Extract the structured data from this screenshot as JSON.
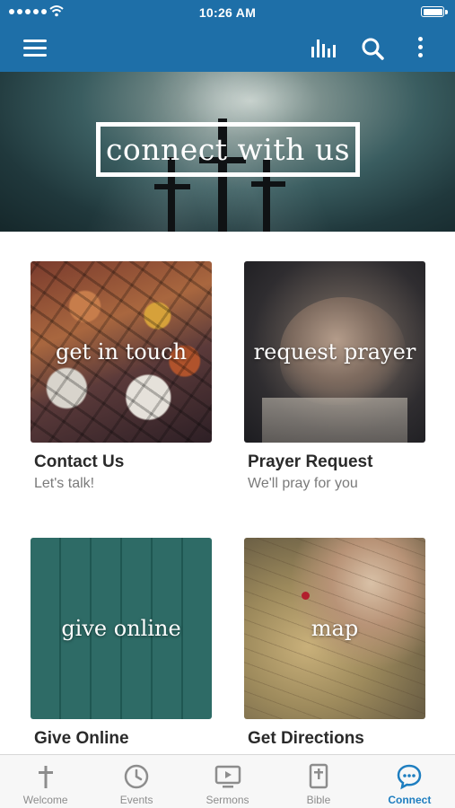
{
  "status_bar": {
    "time": "10:26 AM"
  },
  "colors": {
    "primary": "#1e6fa8",
    "active_tab": "#1e7ec0",
    "inactive_tab": "#8d8d8d"
  },
  "app_bar": {
    "icons": [
      "menu-icon",
      "bar-chart-icon",
      "search-icon",
      "more-vertical-icon"
    ]
  },
  "hero": {
    "title": "connect with us"
  },
  "cards": [
    {
      "overlay": "get in touch",
      "title": "Contact Us",
      "subtitle": "Let's talk!"
    },
    {
      "overlay": "request prayer",
      "title": "Prayer Request",
      "subtitle": "We'll pray for you"
    },
    {
      "overlay": "give online",
      "title": "Give Online",
      "subtitle": ""
    },
    {
      "overlay": "map",
      "title": "Get Directions",
      "subtitle": ""
    }
  ],
  "tabs": [
    {
      "label": "Welcome",
      "icon": "cross-icon",
      "active": false
    },
    {
      "label": "Events",
      "icon": "clock-icon",
      "active": false
    },
    {
      "label": "Sermons",
      "icon": "tv-play-icon",
      "active": false
    },
    {
      "label": "Bible",
      "icon": "bible-icon",
      "active": false
    },
    {
      "label": "Connect",
      "icon": "chat-bubble-icon",
      "active": true
    }
  ]
}
